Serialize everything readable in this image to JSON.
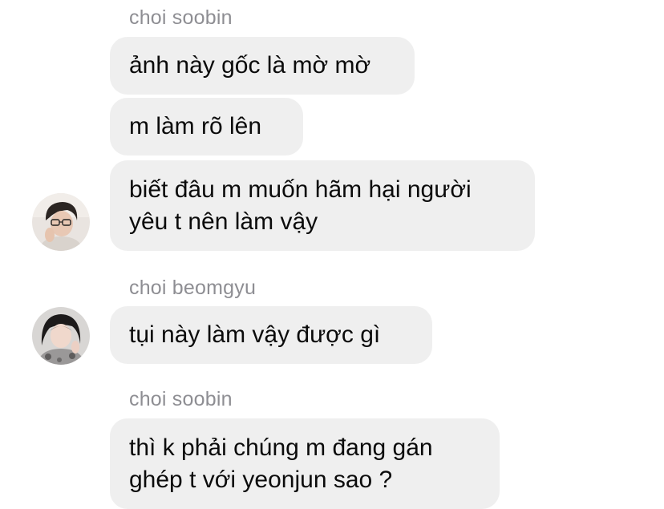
{
  "thread": {
    "groups": [
      {
        "sender": "choi soobin",
        "messages": [
          "ảnh này gốc là mờ mờ",
          "m làm rõ lên",
          "biết đâu m muốn hãm hại người\nyêu t nên làm vậy"
        ],
        "avatar_icon": "user-avatar-soobin-icon"
      },
      {
        "sender": "choi beomgyu",
        "messages": [
          "tụi này làm vậy được gì"
        ],
        "avatar_icon": "user-avatar-beomgyu-icon"
      },
      {
        "sender": "choi soobin",
        "messages": [
          "thì k phải chúng m đang gán\nghép t với yeonjun sao ?"
        ]
      }
    ]
  },
  "colors": {
    "bubble_bg": "#efefef",
    "sender_text": "#8e8e93",
    "message_text": "#0b0b0b",
    "background": "#ffffff"
  }
}
